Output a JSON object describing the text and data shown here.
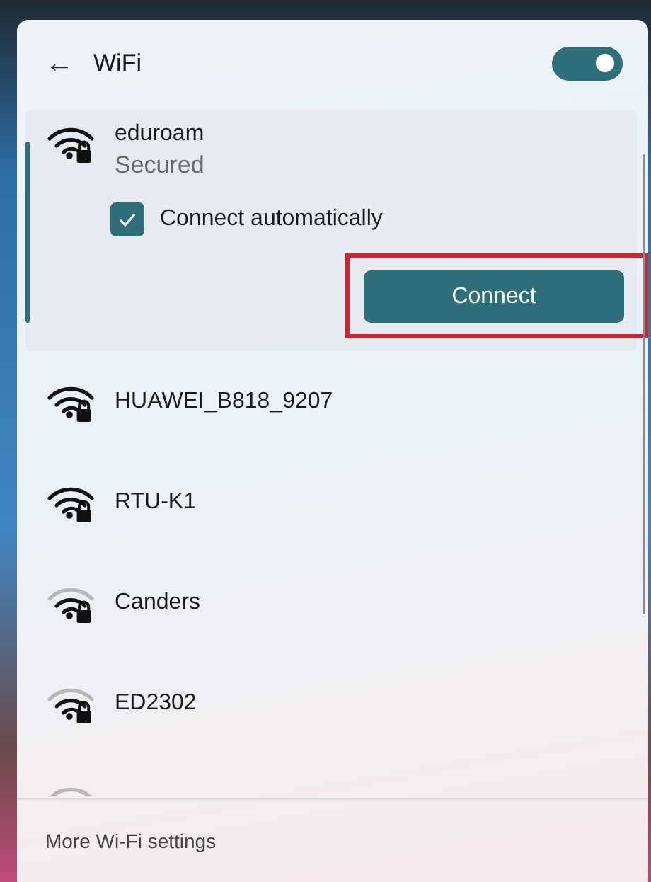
{
  "header": {
    "back": "←",
    "title": "WiFi",
    "wifi_on": true
  },
  "expanded_network": {
    "name": "eduroam",
    "status": "Secured",
    "kind": "full",
    "connect_automatically": {
      "label": "Connect automatically",
      "checked": true
    },
    "connect_button": {
      "label": "Connect",
      "highlighted": true
    }
  },
  "networks": [
    {
      "name": "HUAWEI_B818_9207",
      "kind": "full"
    },
    {
      "name": "RTU-K1",
      "kind": "full"
    },
    {
      "name": "Canders",
      "kind": "medium"
    },
    {
      "name": "ED2302",
      "kind": "medium"
    },
    {
      "kind": "medium",
      "cut_off": true
    }
  ],
  "footer": {
    "link": "More Wi-Fi settings"
  }
}
